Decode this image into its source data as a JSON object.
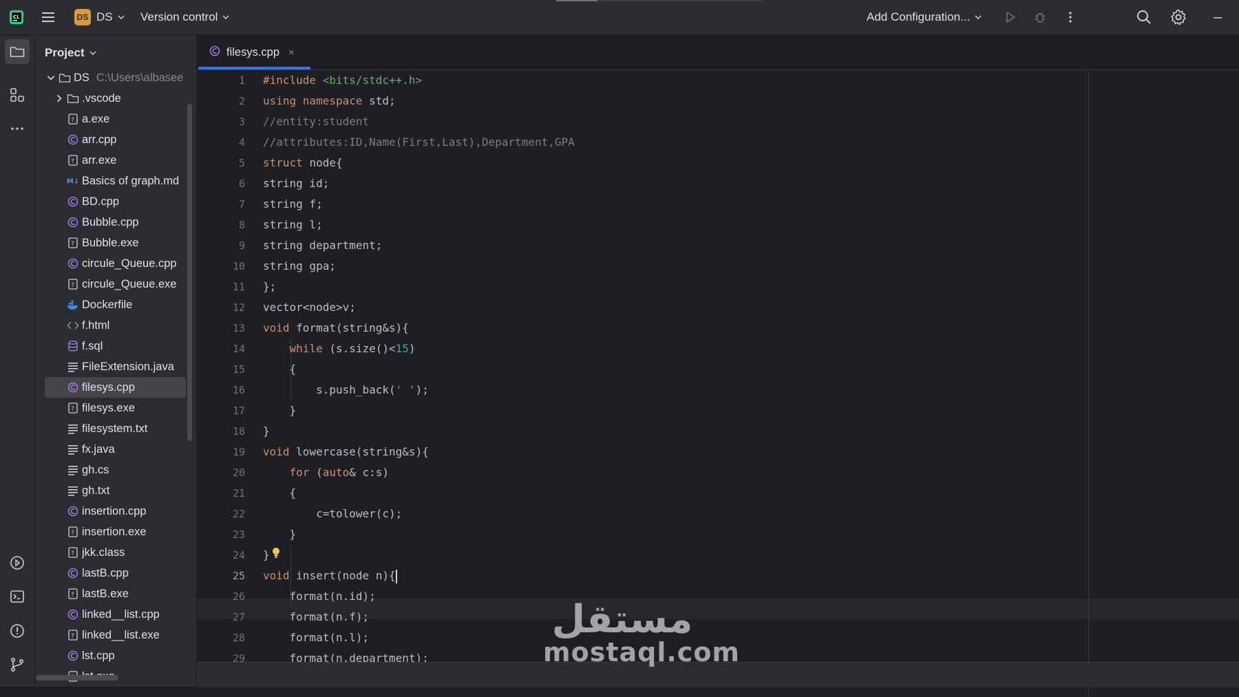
{
  "titlebar": {
    "project_badge": "DS",
    "project_name": "DS",
    "vcs_label": "Version control",
    "run_config_label": "Add Configuration..."
  },
  "project_panel": {
    "title": "Project",
    "root": {
      "name": "DS",
      "path": "C:\\Users\\albasee"
    },
    "items": [
      {
        "name": ".vscode",
        "icon": "folder-icon"
      },
      {
        "name": "a.exe",
        "icon": "unknown-file-icon"
      },
      {
        "name": "arr.cpp",
        "icon": "cpp-file-icon"
      },
      {
        "name": "arr.exe",
        "icon": "unknown-file-icon"
      },
      {
        "name": "Basics of graph.md",
        "icon": "markdown-file-icon"
      },
      {
        "name": "BD.cpp",
        "icon": "cpp-file-icon"
      },
      {
        "name": "Bubble.cpp",
        "icon": "cpp-file-icon"
      },
      {
        "name": "Bubble.exe",
        "icon": "unknown-file-icon"
      },
      {
        "name": "circule_Queue.cpp",
        "icon": "cpp-file-icon"
      },
      {
        "name": "circule_Queue.exe",
        "icon": "unknown-file-icon"
      },
      {
        "name": "Dockerfile",
        "icon": "docker-file-icon"
      },
      {
        "name": "f.html",
        "icon": "html-file-icon"
      },
      {
        "name": "f.sql",
        "icon": "sql-file-icon"
      },
      {
        "name": "FileExtension.java",
        "icon": "text-file-icon"
      },
      {
        "name": "filesys.cpp",
        "icon": "cpp-file-icon",
        "selected": true
      },
      {
        "name": "filesys.exe",
        "icon": "unknown-file-icon"
      },
      {
        "name": "filesystem.txt",
        "icon": "text-file-icon"
      },
      {
        "name": "fx.java",
        "icon": "text-file-icon"
      },
      {
        "name": "gh.cs",
        "icon": "text-file-icon"
      },
      {
        "name": "gh.txt",
        "icon": "text-file-icon"
      },
      {
        "name": "insertion.cpp",
        "icon": "cpp-file-icon"
      },
      {
        "name": "insertion.exe",
        "icon": "unknown-file-icon"
      },
      {
        "name": "jkk.class",
        "icon": "unknown-file-icon"
      },
      {
        "name": "lastB.cpp",
        "icon": "cpp-file-icon"
      },
      {
        "name": "lastB.exe",
        "icon": "unknown-file-icon"
      },
      {
        "name": "linked__list.cpp",
        "icon": "cpp-file-icon"
      },
      {
        "name": "linked__list.exe",
        "icon": "unknown-file-icon"
      },
      {
        "name": "lst.cpp",
        "icon": "cpp-file-icon"
      },
      {
        "name": "lst.exe",
        "icon": "unknown-file-icon"
      }
    ]
  },
  "editor": {
    "tab": {
      "label": "filesys.cpp",
      "close": "×"
    },
    "current_line": 25,
    "lines": [
      [
        [
          "kw",
          "#include "
        ],
        [
          "str",
          "<bits/stdc++.h>"
        ]
      ],
      [
        [
          "kw",
          "using namespace "
        ],
        [
          "p",
          "std;"
        ]
      ],
      [
        [
          "cm",
          "//entity:student"
        ]
      ],
      [
        [
          "cm",
          "//attributes:ID,Name(First,Last),Department,GPA"
        ]
      ],
      [
        [
          "kw",
          "struct "
        ],
        [
          "p",
          "node{"
        ]
      ],
      [
        [
          "p",
          "string id;"
        ]
      ],
      [
        [
          "p",
          "string f;"
        ]
      ],
      [
        [
          "p",
          "string l;"
        ]
      ],
      [
        [
          "p",
          "string department;"
        ]
      ],
      [
        [
          "p",
          "string gpa;"
        ]
      ],
      [
        [
          "p",
          "};"
        ]
      ],
      [
        [
          "p",
          "vector<node>v;"
        ]
      ],
      [
        [
          "kw",
          "void "
        ],
        [
          "p",
          "format(string&s){"
        ]
      ],
      [
        [
          "p",
          "    "
        ],
        [
          "kw",
          "while "
        ],
        [
          "p",
          "(s.size()<"
        ],
        [
          "num",
          "15"
        ],
        [
          "p",
          ")"
        ]
      ],
      [
        [
          "p",
          "    {"
        ]
      ],
      [
        [
          "p",
          "        s.push_back("
        ],
        [
          "str",
          "' '"
        ],
        [
          "p",
          ");"
        ]
      ],
      [
        [
          "p",
          "    }"
        ]
      ],
      [
        [
          "p",
          "}"
        ]
      ],
      [
        [
          "kw",
          "void "
        ],
        [
          "p",
          "lowercase(string&s){"
        ]
      ],
      [
        [
          "p",
          "    "
        ],
        [
          "kw",
          "for "
        ],
        [
          "p",
          "("
        ],
        [
          "kw",
          "auto"
        ],
        [
          "p",
          "& c:s)"
        ]
      ],
      [
        [
          "p",
          "    {"
        ]
      ],
      [
        [
          "p",
          "        c=tolower(c);"
        ]
      ],
      [
        [
          "p",
          "    }"
        ]
      ],
      [
        [
          "p",
          "}"
        ]
      ],
      [
        [
          "kw",
          "void "
        ],
        [
          "p",
          "insert(node n){"
        ]
      ],
      [
        [
          "p",
          "    format(n.id);"
        ]
      ],
      [
        [
          "p",
          "    format(n.f);"
        ]
      ],
      [
        [
          "p",
          "    format(n.l);"
        ]
      ],
      [
        [
          "p",
          "    format(n.department);"
        ]
      ]
    ]
  },
  "watermark": {
    "arabic": "مستقل",
    "latin": "mostaql.com"
  },
  "colors": {
    "accent": "#3574f0",
    "keyword": "#cf8e6d",
    "string": "#6aab73",
    "comment": "#7a7e85",
    "number": "#2aacb8"
  }
}
